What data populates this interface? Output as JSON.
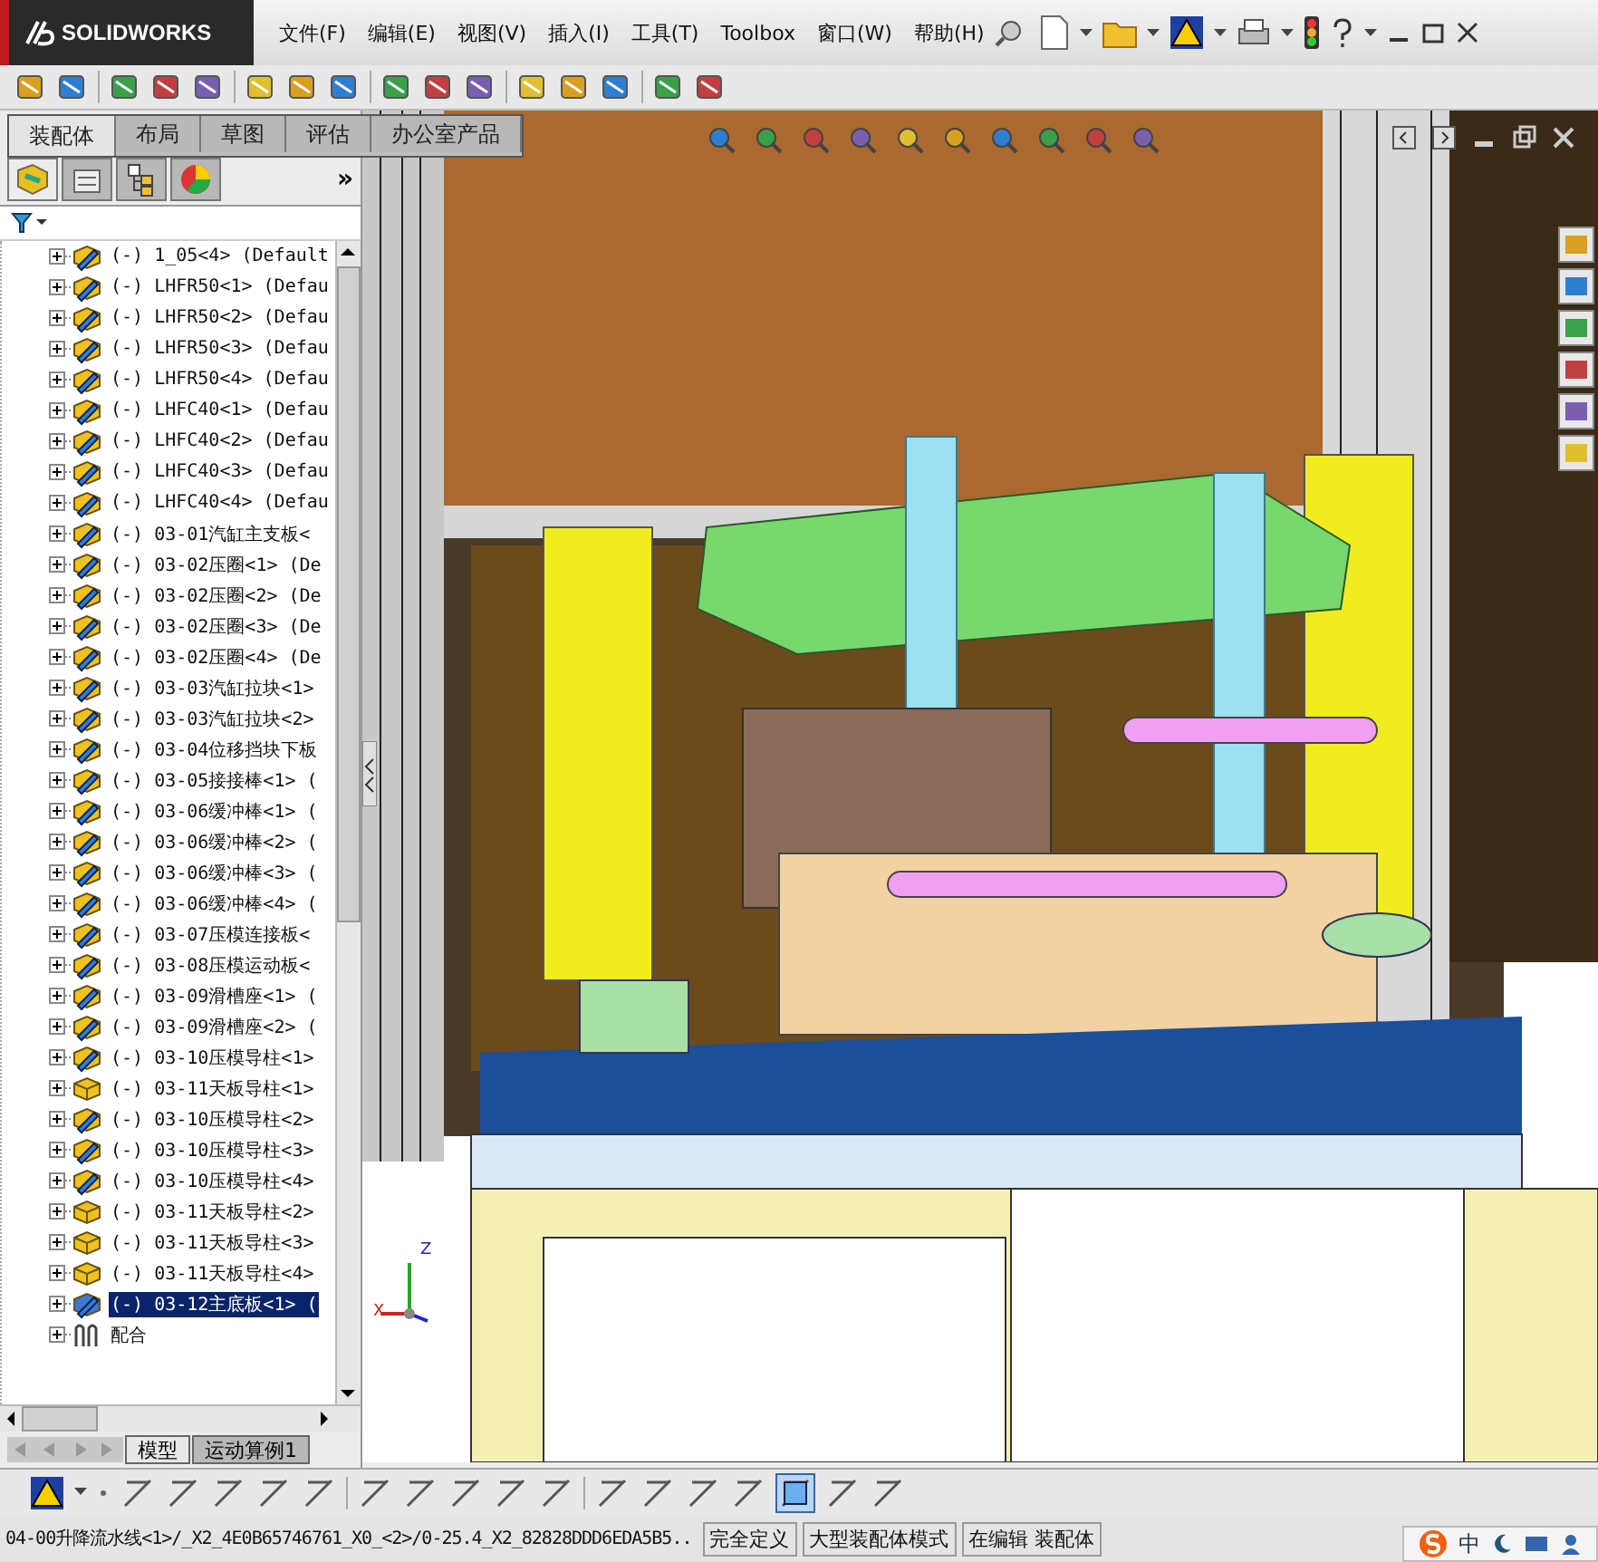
{
  "app_logo": "SOLIDWORKS",
  "menu": [
    "文件(F)",
    "编辑(E)",
    "视图(V)",
    "插入(I)",
    "工具(T)",
    "Toolbox",
    "窗口(W)",
    "帮助(H)"
  ],
  "command_tabs": [
    {
      "label": "装配体",
      "selected": true
    },
    {
      "label": "布局",
      "selected": false
    },
    {
      "label": "草图",
      "selected": false
    },
    {
      "label": "评估",
      "selected": false
    },
    {
      "label": "办公室产品",
      "selected": false
    }
  ],
  "panel_more": "»",
  "tree": {
    "items": [
      {
        "label": "(-) 1_05<4> (Default",
        "kind": "edit",
        "expanded": false,
        "selected": false
      },
      {
        "label": "(-) LHFR50<1> (Defau",
        "kind": "edit",
        "expanded": false,
        "selected": false
      },
      {
        "label": "(-) LHFR50<2> (Defau",
        "kind": "edit",
        "expanded": false,
        "selected": false
      },
      {
        "label": "(-) LHFR50<3> (Defau",
        "kind": "edit",
        "expanded": false,
        "selected": false
      },
      {
        "label": "(-) LHFR50<4> (Defau",
        "kind": "edit",
        "expanded": false,
        "selected": false
      },
      {
        "label": "(-) LHFC40<1> (Defau",
        "kind": "edit",
        "expanded": false,
        "selected": false
      },
      {
        "label": "(-) LHFC40<2> (Defau",
        "kind": "edit",
        "expanded": false,
        "selected": false
      },
      {
        "label": "(-) LHFC40<3> (Defau",
        "kind": "edit",
        "expanded": false,
        "selected": false
      },
      {
        "label": "(-) LHFC40<4> (Defau",
        "kind": "edit",
        "expanded": false,
        "selected": false
      },
      {
        "label": "(-) 03-01汽缸主支板<",
        "kind": "edit",
        "expanded": false,
        "selected": false
      },
      {
        "label": "(-) 03-02压圈<1> (De",
        "kind": "edit",
        "expanded": false,
        "selected": false
      },
      {
        "label": "(-) 03-02压圈<2> (De",
        "kind": "edit",
        "expanded": false,
        "selected": false
      },
      {
        "label": "(-) 03-02压圈<3> (De",
        "kind": "edit",
        "expanded": false,
        "selected": false
      },
      {
        "label": "(-) 03-02压圈<4> (De",
        "kind": "edit",
        "expanded": false,
        "selected": false
      },
      {
        "label": "(-) 03-03汽缸拉块<1>",
        "kind": "edit",
        "expanded": false,
        "selected": false
      },
      {
        "label": "(-) 03-03汽缸拉块<2>",
        "kind": "edit",
        "expanded": false,
        "selected": false
      },
      {
        "label": "(-) 03-04位移挡块下板",
        "kind": "edit",
        "expanded": false,
        "selected": false
      },
      {
        "label": "(-) 03-05接接棒<1> (",
        "kind": "edit",
        "expanded": false,
        "selected": false
      },
      {
        "label": "(-) 03-06缓冲棒<1> (",
        "kind": "edit",
        "expanded": false,
        "selected": false
      },
      {
        "label": "(-) 03-06缓冲棒<2> (",
        "kind": "edit",
        "expanded": false,
        "selected": false
      },
      {
        "label": "(-) 03-06缓冲棒<3> (",
        "kind": "edit",
        "expanded": false,
        "selected": false
      },
      {
        "label": "(-) 03-06缓冲棒<4> (",
        "kind": "edit",
        "expanded": false,
        "selected": false
      },
      {
        "label": "(-) 03-07压模连接板<",
        "kind": "edit",
        "expanded": false,
        "selected": false
      },
      {
        "label": "(-) 03-08压模运动板<",
        "kind": "edit",
        "expanded": false,
        "selected": false
      },
      {
        "label": "(-) 03-09滑槽座<1> (",
        "kind": "edit",
        "expanded": false,
        "selected": false
      },
      {
        "label": "(-) 03-09滑槽座<2> (",
        "kind": "edit",
        "expanded": false,
        "selected": false
      },
      {
        "label": "(-) 03-10压模导柱<1>",
        "kind": "edit",
        "expanded": false,
        "selected": false
      },
      {
        "label": "(-) 03-11天板导柱<1>",
        "kind": "fixed",
        "expanded": false,
        "selected": false
      },
      {
        "label": "(-) 03-10压模导柱<2>",
        "kind": "edit",
        "expanded": false,
        "selected": false
      },
      {
        "label": "(-) 03-10压模导柱<3>",
        "kind": "edit",
        "expanded": false,
        "selected": false
      },
      {
        "label": "(-) 03-10压模导柱<4>",
        "kind": "edit",
        "expanded": false,
        "selected": false
      },
      {
        "label": "(-) 03-11天板导柱<2>",
        "kind": "fixed",
        "expanded": false,
        "selected": false
      },
      {
        "label": "(-) 03-11天板导柱<3>",
        "kind": "fixed",
        "expanded": false,
        "selected": false
      },
      {
        "label": "(-) 03-11天板导柱<4>",
        "kind": "fixed",
        "expanded": false,
        "selected": false
      },
      {
        "label": "(-) 03-12主底板<1> (",
        "kind": "edit",
        "expanded": false,
        "selected": true
      },
      {
        "label": "配合",
        "kind": "mates",
        "expanded": false,
        "selected": false
      }
    ]
  },
  "bottom_tabs": [
    {
      "label": "模型",
      "selected": true
    },
    {
      "label": "运动算例1",
      "selected": false
    }
  ],
  "triad_labels": [
    "Z",
    "X"
  ],
  "status_bar": [
    "04-00升降流水线<1>/_X2_4E0B65746761_X0_<2>/0-25.4_X2_82828DDD6EDA5B5..",
    "完全定义",
    "大型装配体模式",
    "在编辑 装配体"
  ],
  "ime": {
    "label": "中"
  }
}
